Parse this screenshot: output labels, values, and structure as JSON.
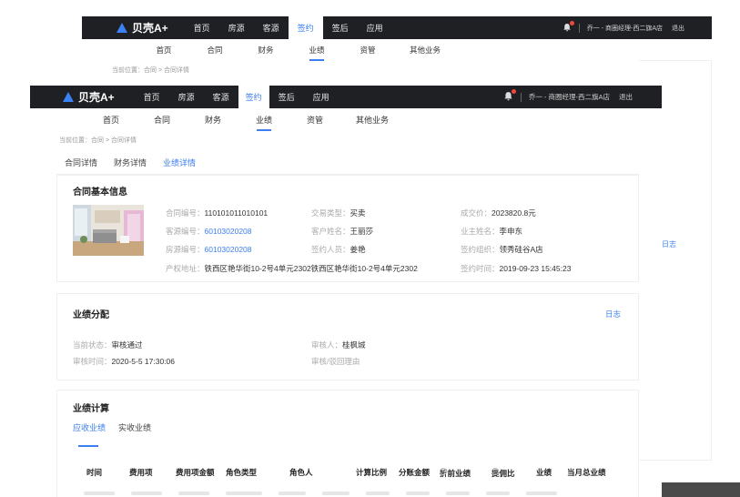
{
  "brand": {
    "name": "贝壳A+"
  },
  "top_nav": [
    {
      "label": "首页",
      "active": false
    },
    {
      "label": "房源",
      "active": false
    },
    {
      "label": "客源",
      "active": false
    },
    {
      "label": "签约",
      "active": true
    },
    {
      "label": "签后",
      "active": false
    },
    {
      "label": "应用",
      "active": false
    }
  ],
  "user": {
    "info": "乔一 - 商圈经理-西二旗A店",
    "logout": "退出"
  },
  "sub_nav": [
    {
      "label": "首页",
      "active": false
    },
    {
      "label": "合同",
      "active": false
    },
    {
      "label": "财务",
      "active": false
    },
    {
      "label": "业绩",
      "active": true
    },
    {
      "label": "资管",
      "active": false
    },
    {
      "label": "其他业务",
      "active": false
    }
  ],
  "back_breadcrumb": "当前位置：合同 > 合同详情",
  "back_right_label": "日志",
  "breadcrumb": "当前位置：合同 > 合同详情",
  "tabs": [
    {
      "label": "合同详情",
      "active": false
    },
    {
      "label": "财务详情",
      "active": false
    },
    {
      "label": "业绩详情",
      "active": true
    }
  ],
  "contract_info": {
    "title": "合同基本信息",
    "fields": {
      "contract_no": {
        "key": "合同编号：",
        "value": "110101011010101"
      },
      "deal_type": {
        "key": "交易类型：",
        "value": "买卖"
      },
      "deal_price": {
        "key": "成交价：",
        "value": "2023820.8元"
      },
      "client_no": {
        "key": "客源编号：",
        "value": "60103020208"
      },
      "client_name": {
        "key": "客户姓名：",
        "value": "王丽莎"
      },
      "owner_name": {
        "key": "业主姓名：",
        "value": "李申东"
      },
      "house_no": {
        "key": "房源编号：",
        "value": "60103020208"
      },
      "signer": {
        "key": "签约人员：",
        "value": "姜艳"
      },
      "sign_org": {
        "key": "签约组织：",
        "value": "领秀硅谷A店"
      },
      "address": {
        "key": "产权地址：",
        "value": "铁西区艳华街10-2号4单元2302铁西区艳华街10-2号4单元2302"
      },
      "sign_time": {
        "key": "签约时间：",
        "value": "2019-09-23 15:45:23"
      }
    }
  },
  "performance_allocation": {
    "title": "业绩分配",
    "log_link": "日志",
    "status": {
      "key": "当前状态：",
      "value": "审核通过"
    },
    "reviewer": {
      "key": "审核人：",
      "value": "桂枫城"
    },
    "review_time": {
      "key": "审核时间：",
      "value": "2020-5-5 17:30:06"
    },
    "reason": {
      "key": "审核/驳回理由",
      "value": ""
    }
  },
  "performance_calc": {
    "title": "业绩计算",
    "tabs": [
      {
        "label": "应收业绩",
        "active": true
      },
      {
        "label": "实收业绩",
        "active": false
      }
    ],
    "columns": [
      "时间",
      "费用项",
      "费用项金额",
      "角色类型",
      "角色人",
      "计算比例",
      "分账金额",
      "折前业绩",
      "提佣比",
      "业绩",
      "当月总业绩"
    ]
  }
}
